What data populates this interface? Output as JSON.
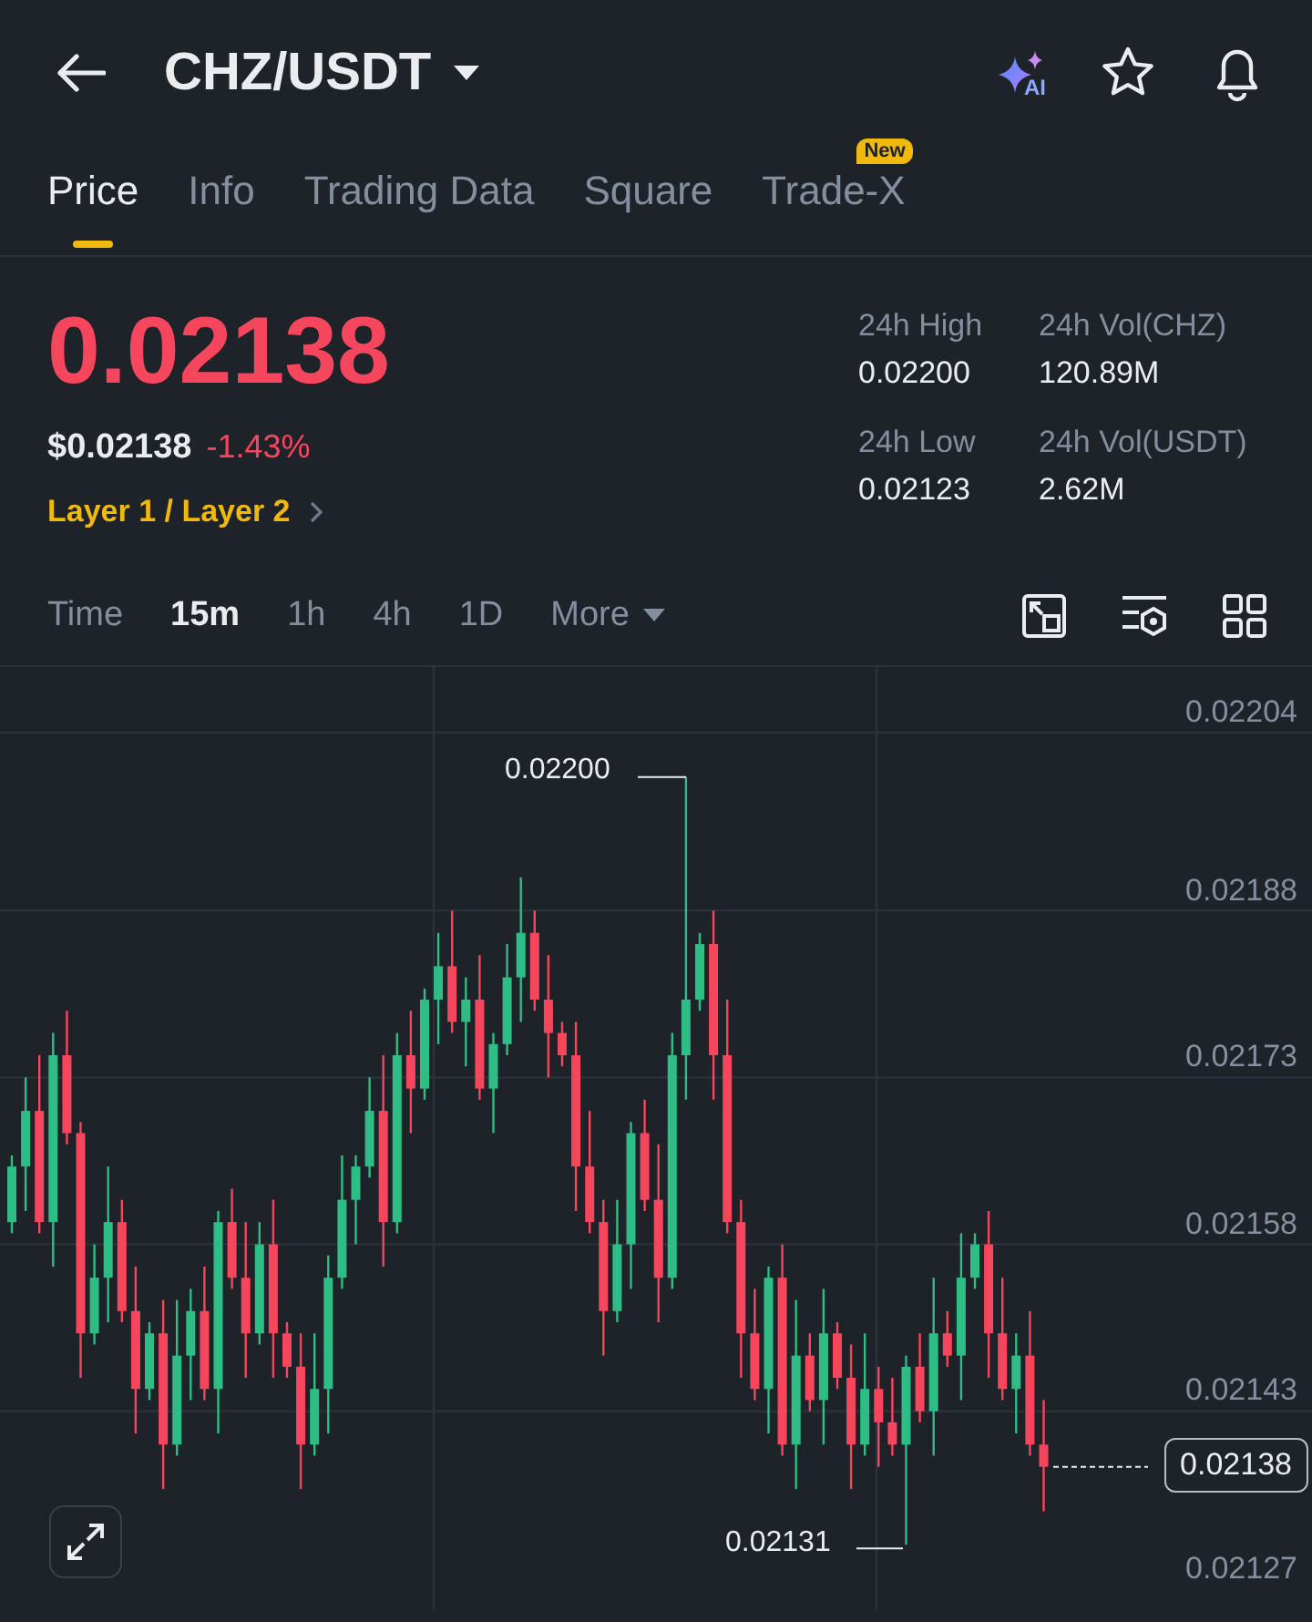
{
  "header": {
    "title": "CHZ/USDT",
    "ai_label": "AI"
  },
  "tabs": [
    {
      "label": "Price",
      "selected": true
    },
    {
      "label": "Info",
      "selected": false
    },
    {
      "label": "Trading Data",
      "selected": false
    },
    {
      "label": "Square",
      "selected": false
    },
    {
      "label": "Trade-X",
      "selected": false,
      "badge": "New"
    }
  ],
  "price": {
    "last": "0.02138",
    "usd": "$0.02138",
    "change": "-1.43%",
    "sector": "Layer 1 / Layer 2"
  },
  "stats": [
    {
      "label": "24h High",
      "value": "0.02200"
    },
    {
      "label": "24h Vol(CHZ)",
      "value": "120.89M"
    },
    {
      "label": "24h Low",
      "value": "0.02123"
    },
    {
      "label": "24h Vol(USDT)",
      "value": "2.62M"
    }
  ],
  "intervals": [
    {
      "label": "Time",
      "selected": false
    },
    {
      "label": "15m",
      "selected": true
    },
    {
      "label": "1h",
      "selected": false
    },
    {
      "label": "4h",
      "selected": false
    },
    {
      "label": "1D",
      "selected": false
    },
    {
      "label": "More",
      "selected": false,
      "kind": "dropdown"
    }
  ],
  "chart": {
    "high_label": "0.02200",
    "low_label": "0.02131",
    "current_price": "0.02138",
    "chart_data": {
      "type": "candlestick",
      "grid": true,
      "ylim": [
        0.02127,
        0.02204
      ],
      "yticks": [
        {
          "value": 0.02204,
          "label": "0.02204"
        },
        {
          "value": 0.02188,
          "label": "0.02188"
        },
        {
          "value": 0.02173,
          "label": "0.02173"
        },
        {
          "value": 0.02158,
          "label": "0.02158"
        },
        {
          "value": 0.02143,
          "label": "0.02143"
        },
        {
          "value": 0.02127,
          "label": "0.02127"
        }
      ],
      "ohlc": [
        [
          0.0216,
          0.02166,
          0.02159,
          0.02165
        ],
        [
          0.02165,
          0.02173,
          0.02161,
          0.0217
        ],
        [
          0.0217,
          0.02175,
          0.02159,
          0.0216
        ],
        [
          0.0216,
          0.02177,
          0.02156,
          0.02175
        ],
        [
          0.02175,
          0.02179,
          0.02167,
          0.02168
        ],
        [
          0.02168,
          0.02169,
          0.02146,
          0.0215
        ],
        [
          0.0215,
          0.02158,
          0.02149,
          0.02155
        ],
        [
          0.02155,
          0.02165,
          0.02151,
          0.0216
        ],
        [
          0.0216,
          0.02162,
          0.02151,
          0.02152
        ],
        [
          0.02152,
          0.02156,
          0.02141,
          0.02145
        ],
        [
          0.02145,
          0.02151,
          0.02144,
          0.0215
        ],
        [
          0.0215,
          0.02153,
          0.02136,
          0.0214
        ],
        [
          0.0214,
          0.02153,
          0.02139,
          0.02148
        ],
        [
          0.02148,
          0.02154,
          0.02144,
          0.02152
        ],
        [
          0.02152,
          0.02156,
          0.02144,
          0.02145
        ],
        [
          0.02145,
          0.02161,
          0.02141,
          0.0216
        ],
        [
          0.0216,
          0.02163,
          0.02154,
          0.02155
        ],
        [
          0.02155,
          0.0216,
          0.02146,
          0.0215
        ],
        [
          0.0215,
          0.0216,
          0.02149,
          0.02158
        ],
        [
          0.02158,
          0.02162,
          0.02146,
          0.0215
        ],
        [
          0.0215,
          0.02151,
          0.02146,
          0.02147
        ],
        [
          0.02147,
          0.0215,
          0.02136,
          0.0214
        ],
        [
          0.0214,
          0.0215,
          0.02139,
          0.02145
        ],
        [
          0.02145,
          0.02157,
          0.02141,
          0.02155
        ],
        [
          0.02155,
          0.02166,
          0.02154,
          0.02162
        ],
        [
          0.02162,
          0.02166,
          0.02158,
          0.02165
        ],
        [
          0.02165,
          0.02173,
          0.02164,
          0.0217
        ],
        [
          0.0217,
          0.02175,
          0.02156,
          0.0216
        ],
        [
          0.0216,
          0.02177,
          0.02159,
          0.02175
        ],
        [
          0.02175,
          0.02179,
          0.02168,
          0.02172
        ],
        [
          0.02172,
          0.02181,
          0.02171,
          0.0218
        ],
        [
          0.0218,
          0.02186,
          0.02176,
          0.02183
        ],
        [
          0.02183,
          0.02188,
          0.02177,
          0.02178
        ],
        [
          0.02178,
          0.02182,
          0.02174,
          0.0218
        ],
        [
          0.0218,
          0.02184,
          0.02171,
          0.02172
        ],
        [
          0.02172,
          0.02177,
          0.02168,
          0.02176
        ],
        [
          0.02176,
          0.02185,
          0.02175,
          0.02182
        ],
        [
          0.02182,
          0.02191,
          0.02178,
          0.02186
        ],
        [
          0.02186,
          0.02188,
          0.02179,
          0.0218
        ],
        [
          0.0218,
          0.02184,
          0.02173,
          0.02177
        ],
        [
          0.02177,
          0.02178,
          0.02174,
          0.02175
        ],
        [
          0.02175,
          0.02178,
          0.02161,
          0.02165
        ],
        [
          0.02165,
          0.0217,
          0.02159,
          0.0216
        ],
        [
          0.0216,
          0.02162,
          0.02148,
          0.02152
        ],
        [
          0.02152,
          0.02162,
          0.02151,
          0.02158
        ],
        [
          0.02158,
          0.02169,
          0.02154,
          0.02168
        ],
        [
          0.02168,
          0.02171,
          0.02161,
          0.02162
        ],
        [
          0.02162,
          0.02167,
          0.02151,
          0.02155
        ],
        [
          0.02155,
          0.02177,
          0.02154,
          0.02175
        ],
        [
          0.02175,
          0.022,
          0.02171,
          0.0218
        ],
        [
          0.0218,
          0.02186,
          0.02179,
          0.02185
        ],
        [
          0.02185,
          0.02188,
          0.02171,
          0.02175
        ],
        [
          0.02175,
          0.0218,
          0.02159,
          0.0216
        ],
        [
          0.0216,
          0.02162,
          0.02146,
          0.0215
        ],
        [
          0.0215,
          0.02154,
          0.02144,
          0.02145
        ],
        [
          0.02145,
          0.02156,
          0.02141,
          0.02155
        ],
        [
          0.02155,
          0.02158,
          0.02139,
          0.0214
        ],
        [
          0.0214,
          0.02153,
          0.02136,
          0.02148
        ],
        [
          0.02148,
          0.0215,
          0.02143,
          0.02144
        ],
        [
          0.02144,
          0.02154,
          0.0214,
          0.0215
        ],
        [
          0.0215,
          0.02151,
          0.02145,
          0.02146
        ],
        [
          0.02146,
          0.02149,
          0.02136,
          0.0214
        ],
        [
          0.0214,
          0.0215,
          0.02139,
          0.02145
        ],
        [
          0.02145,
          0.02147,
          0.02138,
          0.02142
        ],
        [
          0.02142,
          0.02146,
          0.02139,
          0.0214
        ],
        [
          0.0214,
          0.02148,
          0.02131,
          0.02147
        ],
        [
          0.02147,
          0.0215,
          0.02142,
          0.02143
        ],
        [
          0.02143,
          0.02155,
          0.02139,
          0.0215
        ],
        [
          0.0215,
          0.02152,
          0.02147,
          0.02148
        ],
        [
          0.02148,
          0.02159,
          0.02144,
          0.02155
        ],
        [
          0.02155,
          0.02159,
          0.02154,
          0.02158
        ],
        [
          0.02158,
          0.02161,
          0.02146,
          0.0215
        ],
        [
          0.0215,
          0.02155,
          0.02144,
          0.02145
        ],
        [
          0.02145,
          0.0215,
          0.02141,
          0.02148
        ],
        [
          0.02148,
          0.02152,
          0.02139,
          0.0214
        ],
        [
          0.0214,
          0.02144,
          0.02134,
          0.02138
        ]
      ]
    }
  }
}
